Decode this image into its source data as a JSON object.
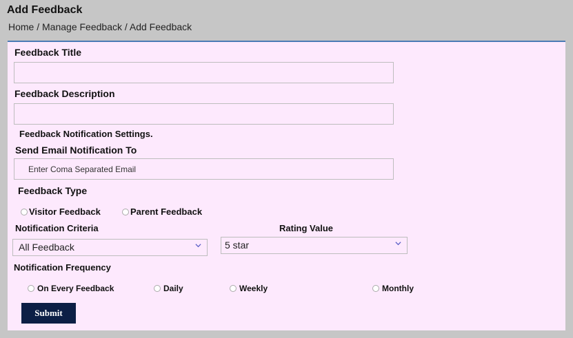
{
  "page": {
    "title": "Add Feedback",
    "breadcrumb": "Home / Manage Feedback / Add Feedback"
  },
  "form": {
    "feedback_title": {
      "label": "Feedback Title",
      "value": ""
    },
    "feedback_description": {
      "label": "Feedback Description",
      "value": ""
    },
    "notification_settings_heading": "Feedback Notification Settings.",
    "send_email": {
      "label": "Send Email Notification To",
      "placeholder": "Enter Coma Separated Email"
    },
    "feedback_type": {
      "label": "Feedback Type",
      "options": [
        "Visitor Feedback",
        "Parent Feedback"
      ]
    },
    "notification_criteria": {
      "label": "Notification Criteria",
      "selected": "All Feedback"
    },
    "rating_value": {
      "label": "Rating Value",
      "selected": "5 star"
    },
    "notification_frequency": {
      "label": "Notification Frequency",
      "options": [
        "On Every Feedback",
        "Daily",
        "Weekly",
        "Monthly"
      ]
    },
    "submit_label": "Submit"
  },
  "colors": {
    "panel_bg": "#fde9fd",
    "header_bg": "#c6c6c6",
    "accent_border": "#4a7ab5",
    "submit_bg": "#0c1f45"
  },
  "icons": {
    "dropdown": "chevron-down-icon",
    "radio": "radio-button-icon"
  }
}
